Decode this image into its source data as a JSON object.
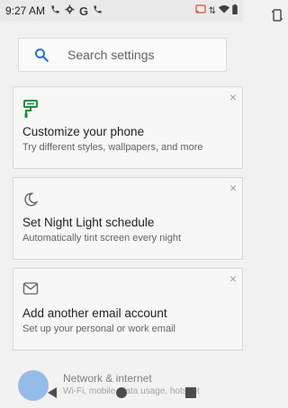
{
  "status_bar": {
    "time": "9:27 AM",
    "left_icons": [
      "phone-icon",
      "gear-icon",
      "google-icon",
      "phone-icon"
    ],
    "right_icons": [
      "cast-icon",
      "data-arrows-icon",
      "wifi-icon",
      "battery-icon"
    ]
  },
  "search": {
    "placeholder": "Search settings",
    "icon": "search-icon",
    "accent": "#1a73e8"
  },
  "cards": [
    {
      "icon": "paint-roller-icon",
      "title": "Customize your phone",
      "subtitle": "Try different styles, wallpapers, and more",
      "dismiss": "×"
    },
    {
      "icon": "moon-icon",
      "title": "Set Night Light schedule",
      "subtitle": "Automatically tint screen every night",
      "dismiss": "×"
    },
    {
      "icon": "gmail-icon",
      "title": "Add another email account",
      "subtitle": "Set up your personal or work email",
      "dismiss": "×"
    }
  ],
  "list_peek": {
    "icon": "wifi-icon",
    "title": "Network & internet",
    "subtitle": "Wi-Fi, mobile, data usage, hotspot",
    "color": "#4a90e2"
  },
  "nav_bar": {
    "buttons": [
      "back-icon",
      "home-icon",
      "recents-icon",
      "rotate-icon"
    ]
  }
}
